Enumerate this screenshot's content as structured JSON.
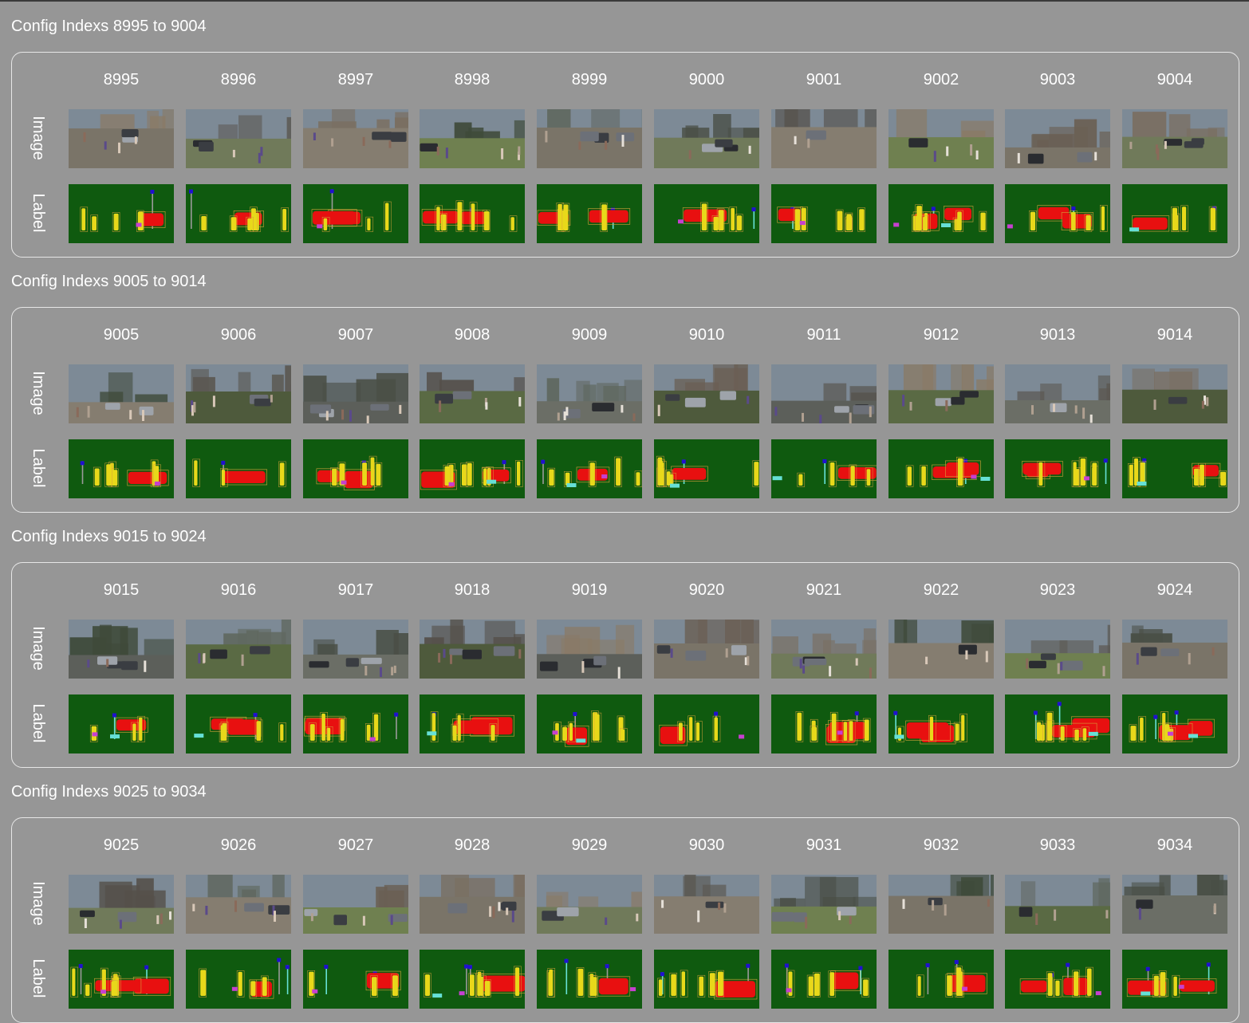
{
  "colors": {
    "background": "#969696",
    "text": "#ffffff",
    "border": "#e6e6e6",
    "label_background": "#0f5a0f",
    "label_vehicle": "#e81010",
    "label_person": "#e8d81a",
    "label_bbox": "#d6a23a",
    "label_pole": "#2f7de0",
    "label_sign": "#2010d0",
    "label_accent": "#c640d0",
    "label_cyan": "#66e0d6"
  },
  "row_labels": {
    "image": "Image",
    "label": "Label"
  },
  "groups": [
    {
      "title": "Config Indexs 8995 to 9004",
      "indices": [
        "8995",
        "8996",
        "8997",
        "8998",
        "8999",
        "9000",
        "9001",
        "9002",
        "9003",
        "9004"
      ]
    },
    {
      "title": "Config Indexs 9005 to 9014",
      "indices": [
        "9005",
        "9006",
        "9007",
        "9008",
        "9009",
        "9010",
        "9011",
        "9012",
        "9013",
        "9014"
      ]
    },
    {
      "title": "Config Indexs 9015 to 9024",
      "indices": [
        "9015",
        "9016",
        "9017",
        "9018",
        "9019",
        "9020",
        "9021",
        "9022",
        "9023",
        "9024"
      ]
    },
    {
      "title": "Config Indexs 9025 to 9034",
      "indices": [
        "9025",
        "9026",
        "9027",
        "9028",
        "9029",
        "9030",
        "9031",
        "9032",
        "9033",
        "9034"
      ]
    }
  ]
}
